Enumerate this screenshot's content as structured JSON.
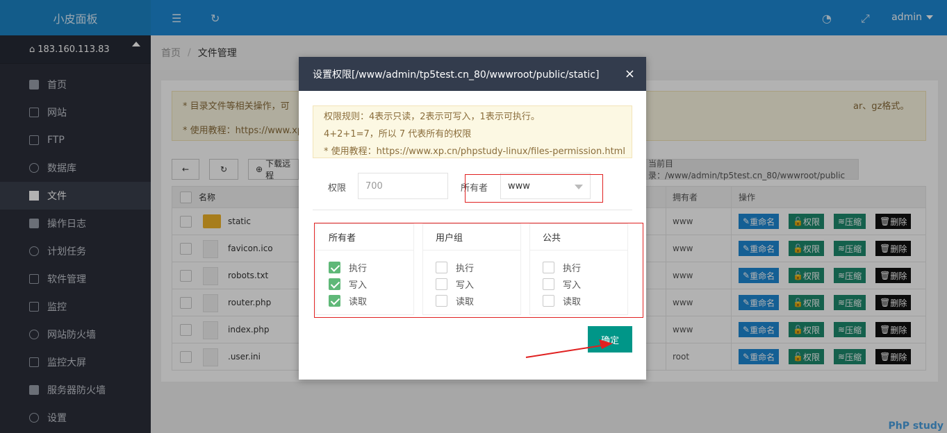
{
  "sidebar": {
    "brand": "小皮面板",
    "server_ip": "183.160.113.83",
    "items": [
      {
        "label": "首页",
        "icon": "home-icon"
      },
      {
        "label": "网站",
        "icon": "monitor-icon"
      },
      {
        "label": "FTP",
        "icon": "ftp-icon"
      },
      {
        "label": "数据库",
        "icon": "database-icon"
      },
      {
        "label": "文件",
        "icon": "folder-icon"
      },
      {
        "label": "操作日志",
        "icon": "layers-icon"
      },
      {
        "label": "计划任务",
        "icon": "clock-icon"
      },
      {
        "label": "软件管理",
        "icon": "download-icon"
      },
      {
        "label": "监控",
        "icon": "chart-icon"
      },
      {
        "label": "网站防火墙",
        "icon": "shield-icon"
      },
      {
        "label": "监控大屏",
        "icon": "screen-icon"
      },
      {
        "label": "服务器防火墙",
        "icon": "security-icon"
      },
      {
        "label": "设置",
        "icon": "gear-icon"
      }
    ]
  },
  "topbar": {
    "user": "admin"
  },
  "breadcrumb": {
    "home": "首页",
    "sep": "/",
    "current": "文件管理"
  },
  "page": {
    "notice1_left": "* 目录文件等相关操作，可",
    "notice1_right": "ar、gz格式。",
    "notice2_left": "* 使用教程：https://www.xp",
    "download_label": "下载远程",
    "current_dir": "当前目录：/www/admin/tp5test.cn_80/wwwroot/public"
  },
  "table": {
    "headers": {
      "name": "名称",
      "owner": "拥有者",
      "ops": "操作"
    },
    "op_labels": {
      "rename": "重命名",
      "perm": "权限",
      "compress": "压缩",
      "delete": "删除"
    },
    "rows": [
      {
        "name": "static",
        "owner": "www"
      },
      {
        "name": "favicon.ico",
        "owner": "www"
      },
      {
        "name": "robots.txt",
        "owner": "www"
      },
      {
        "name": "router.php",
        "owner": "www"
      },
      {
        "name": "index.php",
        "owner": "www"
      },
      {
        "name": ".user.ini",
        "owner": "root"
      }
    ]
  },
  "modal": {
    "title": "设置权限[/www/admin/tp5test.cn_80/wwwroot/public/static]",
    "rule1": "权限规则：4表示只读，2表示可写入，1表示可执行。",
    "rule2": "4+2+1=7，所以 7 代表所有的权限",
    "rule3": "* 使用教程：https://www.xp.cn/phpstudy-linux/files-permission.html",
    "perm_label": "权限",
    "perm_placeholder": "700",
    "owner_label": "所有者",
    "owner_value": "www",
    "groups": [
      {
        "title": "所有者",
        "exec": "执行",
        "write": "写入",
        "read": "读取",
        "exec_on": true,
        "write_on": true,
        "read_on": true
      },
      {
        "title": "用户组",
        "exec": "执行",
        "write": "写入",
        "read": "读取",
        "exec_on": false,
        "write_on": false,
        "read_on": false
      },
      {
        "title": "公共",
        "exec": "执行",
        "write": "写入",
        "read": "读取",
        "exec_on": false,
        "write_on": false,
        "read_on": false
      }
    ],
    "confirm": "确定"
  },
  "watermark": "PhP study",
  "colors": {
    "accent": "#1e88d5",
    "confirm": "#009688",
    "annotation": "#e02020"
  }
}
